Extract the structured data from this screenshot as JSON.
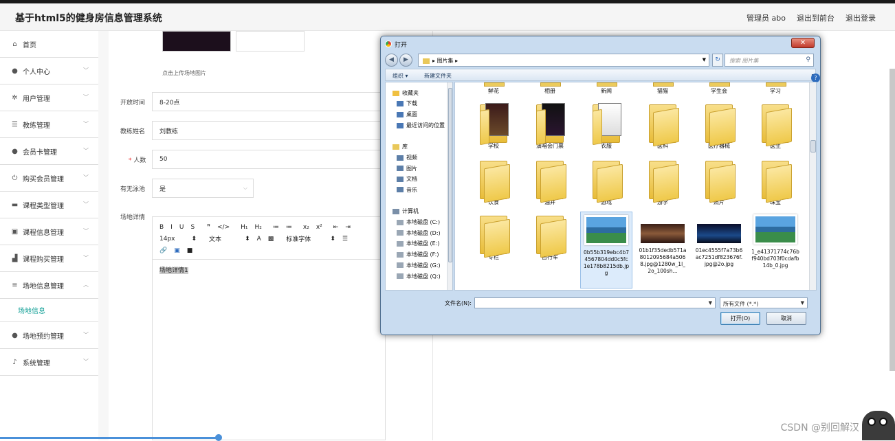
{
  "header": {
    "title": "基于html5的健身房信息管理系统",
    "links": [
      "管理员 abo",
      "退出到前台",
      "退出登录"
    ]
  },
  "sidebar": {
    "items": [
      {
        "label": "首页",
        "icon": "home-icon",
        "glyph": "⌂",
        "chevron": false
      },
      {
        "label": "个人中心",
        "icon": "user-icon",
        "glyph": "●",
        "chevron": true
      },
      {
        "label": "用户管理",
        "icon": "settings-icon",
        "glyph": "✲",
        "chevron": true
      },
      {
        "label": "教练管理",
        "icon": "sliders-icon",
        "glyph": "☰",
        "chevron": true
      },
      {
        "label": "会员卡管理",
        "icon": "user-icon",
        "glyph": "●",
        "chevron": true
      },
      {
        "label": "购买会员管理",
        "icon": "power-icon",
        "glyph": "⏻",
        "chevron": true
      },
      {
        "label": "课程类型管理",
        "icon": "monitor-icon",
        "glyph": "▬",
        "chevron": true
      },
      {
        "label": "课程信息管理",
        "icon": "image-icon",
        "glyph": "▣",
        "chevron": true
      },
      {
        "label": "课程购买管理",
        "icon": "chart-icon",
        "glyph": "▟",
        "chevron": true
      },
      {
        "label": "场地信息管理",
        "icon": "list-icon",
        "glyph": "≡",
        "chevron": true,
        "expanded": true
      }
    ],
    "sub_item": "场地信息",
    "items_after": [
      {
        "label": "场地预约管理",
        "icon": "user-icon",
        "glyph": "●",
        "chevron": true
      },
      {
        "label": "系统管理",
        "icon": "mic-icon",
        "glyph": "♪",
        "chevron": true
      }
    ]
  },
  "form": {
    "upload_hint": "点击上传场地图片",
    "open_time_label": "开放时间",
    "open_time_value": "8-20点",
    "coach_label": "教练姓名",
    "coach_value": "刘教练",
    "people_label": "人数",
    "people_required": "*",
    "people_value": "50",
    "pool_label": "有无泳池",
    "pool_value": "是",
    "detail_label": "场地详情",
    "editor": {
      "row1": [
        "B",
        "I",
        "U",
        "S",
        "❞",
        "</>",
        "H₁",
        "H₂",
        "≔",
        "≔",
        "x₂",
        "x²",
        "⇤",
        "⇥"
      ],
      "font_size": "14px",
      "text_type": "文本",
      "font_family": "标准字体",
      "content": "场地详情1"
    }
  },
  "dialog": {
    "title": "打开",
    "close": "✕",
    "address": "图片集",
    "search_placeholder": "搜索 图片集",
    "organize": "组织 ▾",
    "new_folder": "新建文件夹",
    "nav": {
      "favorites": "收藏夹",
      "fav_items": [
        "下载",
        "桌面",
        "最近访问的位置"
      ],
      "libraries": "库",
      "lib_items": [
        "视频",
        "图片",
        "文档",
        "音乐"
      ],
      "computer": "计算机",
      "drives": [
        "本地磁盘 (C:)",
        "本地磁盘 (D:)",
        "本地磁盘 (E:)",
        "本地磁盘 (F:)",
        "本地磁盘 (G:)",
        "本地磁盘 (Q:)"
      ]
    },
    "row0": [
      "鲜花",
      "相册",
      "新闻",
      "猫猫",
      "学生会",
      "学习"
    ],
    "row1": [
      "学校",
      "演唱会门票",
      "衣服",
      "医科",
      "医疗器械",
      "医生"
    ],
    "row2": [
      "饮食",
      "油井",
      "游戏",
      "游学",
      "照片",
      "珠宝"
    ],
    "row3_folders": [
      "专栏",
      "自行车"
    ],
    "row3_files": [
      "0b55b319ebc4b74567804dd0c5fc1e178b8215db.jpg",
      "01b1f35dedb571a8012095684a5068.jpg@1280w_1l_2o_100sh...",
      "01ec4555f7a73b6ac7251df823676f.jpg@2o.jpg",
      "1_e41371774c76bf940bd703f0cdafb14b_0.jpg"
    ],
    "filename_label": "文件名(N):",
    "filetype": "所有文件 (*.*)",
    "open_btn": "打开(O)",
    "cancel_btn": "取消"
  },
  "watermark": "CSDN @别回解汉"
}
